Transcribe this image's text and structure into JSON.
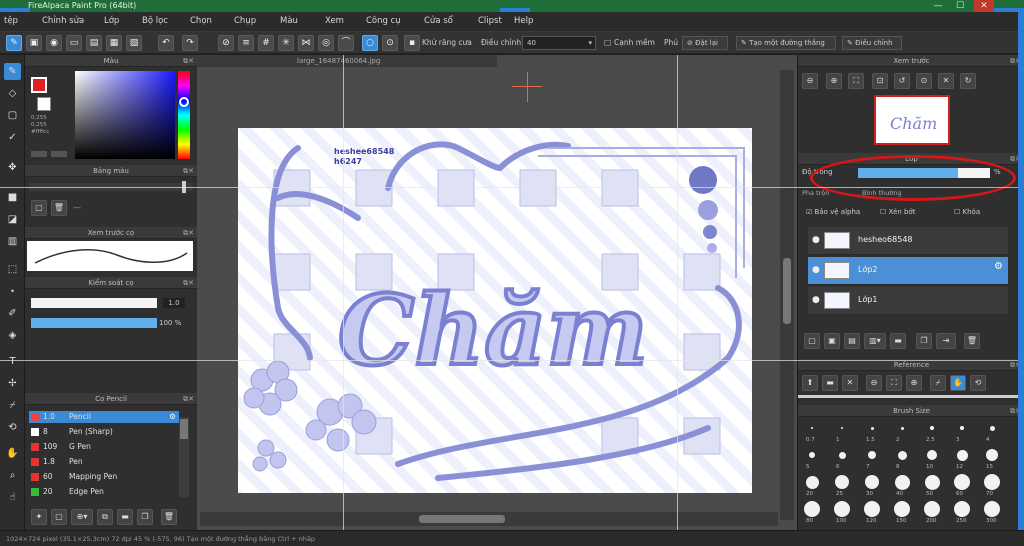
{
  "window": {
    "title": "FireAlpaca Paint Pro (64bit)",
    "controls": [
      "—",
      "☐",
      "✕"
    ]
  },
  "menu": [
    "tệp",
    "Chỉnh sửa",
    "Lớp",
    "Bộ lọc",
    "Chọn",
    "Chụp",
    "Màu",
    "Xem",
    "Công cụ",
    "Cửa sổ",
    "Clipst",
    "Help"
  ],
  "toolbar": {
    "smoothing_label": "Khử răng cưa",
    "correction_label": "Điều chỉnh",
    "correction_value": "40",
    "edge_label": "Cạnh mềm",
    "fill_label": "Phủ",
    "fill_btn": "Đặt lại",
    "new_ruler": "Tạo một đường thẳng",
    "adjust": "Điều chỉnh"
  },
  "panels": {
    "color": "Màu",
    "palette": "Bảng màu",
    "brush_preview": "Xem trước cọ",
    "brush_control": "Kiểm soát cọ",
    "brush_size_value": "1.0",
    "brush_opacity_value": "100 %",
    "pencil_panel": "Cọ Pencil",
    "navigator": "Xem trước",
    "layer": "Lớp",
    "opacity_label": "Độ trong",
    "opacity_value": "% ",
    "blend_label": "Pha trộn",
    "blend_value": "Bình thường",
    "protect_alpha": "Bảo vệ alpha",
    "clipping": "Xén bớt",
    "lock": "Khóa",
    "reference": "Reference",
    "brush_size": "Brush Size"
  },
  "color_values": {
    "h": "0,255",
    "s": "0,255",
    "v": "#ffffcc"
  },
  "doc_tab": "large_16487460064.jpg",
  "canvas": {
    "watermark_line1": "heshee68548",
    "watermark_line2": "h6247",
    "main_text": "Chăm"
  },
  "brushes": [
    {
      "size": "1.0",
      "name": "Pencil",
      "color": "#e64646",
      "sel": true
    },
    {
      "size": "8",
      "name": "Pen (Sharp)",
      "color": "#ffffff",
      "sel": false
    },
    {
      "size": "109",
      "name": "G Pen",
      "color": "#e63232",
      "sel": false
    },
    {
      "size": "1.8",
      "name": "Pen",
      "color": "#e63232",
      "sel": false
    },
    {
      "size": "60",
      "name": "Mapping Pen",
      "color": "#e63232",
      "sel": false
    },
    {
      "size": "20",
      "name": "Edge Pen",
      "color": "#3ab83a",
      "sel": false
    }
  ],
  "layers": [
    {
      "name": "hesheo68548",
      "sel": false
    },
    {
      "name": "Lớp2",
      "sel": true
    },
    {
      "name": "Lớp1",
      "sel": false
    }
  ],
  "brush_sizes": {
    "row1": [
      "0.7",
      "1",
      "1.5",
      "2",
      "2.5",
      "3",
      "4"
    ],
    "row2": [
      "5",
      "6",
      "7",
      "8",
      "10",
      "12",
      "15"
    ],
    "row3": [
      "20",
      "25",
      "30",
      "40",
      "50",
      "60",
      "70"
    ],
    "row4": [
      "80",
      "100",
      "120",
      "150",
      "200",
      "250",
      "300"
    ]
  },
  "status": "1024×724 pixel (35.1×25.3cm) 72 dpi 45 %  (-575, 96)  Tạo một đường thẳng bằng Ctrl + nhấp"
}
